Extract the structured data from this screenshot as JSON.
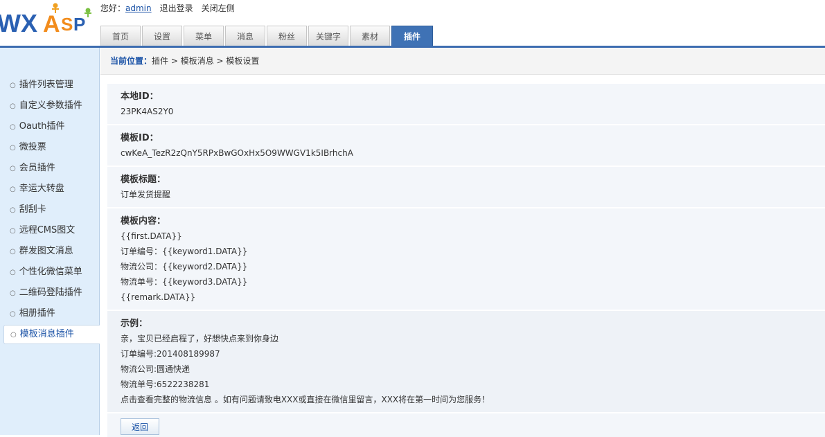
{
  "topbar": {
    "greeting": "您好：",
    "username": "admin",
    "logout": "退出登录",
    "close_left": "关闭左侧"
  },
  "logo": {
    "text": "WXASP"
  },
  "nav": {
    "tabs": [
      {
        "label": "首页"
      },
      {
        "label": "设置"
      },
      {
        "label": "菜单"
      },
      {
        "label": "消息"
      },
      {
        "label": "粉丝"
      },
      {
        "label": "关键字"
      },
      {
        "label": "素材"
      },
      {
        "label": "插件"
      }
    ],
    "active_index": 7
  },
  "sidebar": {
    "items": [
      {
        "label": "插件列表管理"
      },
      {
        "label": "自定义参数插件"
      },
      {
        "label": "Oauth插件"
      },
      {
        "label": "微投票"
      },
      {
        "label": "会员插件"
      },
      {
        "label": "幸运大转盘"
      },
      {
        "label": "刮刮卡"
      },
      {
        "label": "远程CMS图文"
      },
      {
        "label": "群发图文消息"
      },
      {
        "label": "个性化微信菜单"
      },
      {
        "label": "二维码登陆插件"
      },
      {
        "label": "相册插件"
      },
      {
        "label": "模板消息插件"
      }
    ],
    "active_index": 12
  },
  "breadcrumb": {
    "label": "当前位置：",
    "path": "插件 > 模板消息 > 模板设置"
  },
  "form": {
    "local_id": {
      "label": "本地ID：",
      "value": "23PK4AS2Y0"
    },
    "template_id": {
      "label": "模板ID：",
      "value": "cwKeA_TezR2zQnY5RPxBwGOxHx5O9WWGV1k5IBrhchA"
    },
    "template_title": {
      "label": "模板标题：",
      "value": "订单发货提醒"
    },
    "template_content": {
      "label": "模板内容：",
      "lines": [
        "{{first.DATA}}",
        "订单编号：{{keyword1.DATA}}",
        "物流公司：{{keyword2.DATA}}",
        "物流单号：{{keyword3.DATA}}",
        "{{remark.DATA}}"
      ]
    },
    "example": {
      "label": "示例：",
      "lines": [
        "亲，宝贝已经启程了，好想快点来到你身边",
        "订单编号:201408189987",
        "物流公司:圆通快递",
        "物流单号:6522238281",
        "点击查看完整的物流信息 。如有问题请致电XXX或直接在微信里留言，XXX将在第一时间为您服务！"
      ]
    },
    "back_label": "返回"
  },
  "colors": {
    "accent": "#3f72b5",
    "sidebar_bg": "#e0eefb",
    "link": "#1a52a6"
  }
}
